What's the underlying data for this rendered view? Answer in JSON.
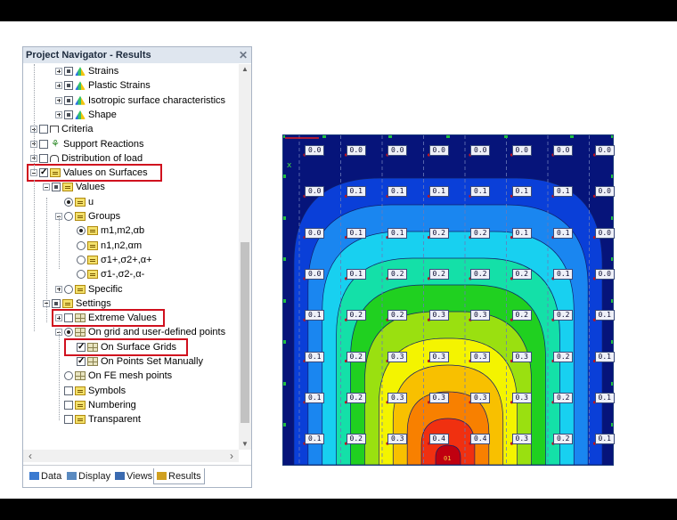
{
  "navigator": {
    "title": "Project Navigator - Results",
    "close_glyph": "✕",
    "items": [
      {
        "label": "Strains",
        "depth": 3,
        "expander": "plus",
        "check": "partial",
        "icon": "result-icon"
      },
      {
        "label": "Plastic Strains",
        "depth": 3,
        "expander": "plus",
        "check": "partial",
        "icon": "result-icon"
      },
      {
        "label": "Isotropic surface characteristics",
        "depth": 3,
        "expander": "plus",
        "check": "partial",
        "icon": "result-icon"
      },
      {
        "label": "Shape",
        "depth": 3,
        "expander": "plus",
        "check": "partial",
        "icon": "result-icon"
      },
      {
        "label": "Criteria",
        "depth": 1,
        "expander": "plus",
        "check": "none",
        "icon": "criteria-icon"
      },
      {
        "label": "Support Reactions",
        "depth": 1,
        "expander": "plus",
        "check": "none",
        "icon": "support-icon"
      },
      {
        "label": "Distribution of load",
        "depth": 1,
        "expander": "plus",
        "check": "none",
        "icon": "load-icon"
      },
      {
        "label": "Values on Surfaces",
        "depth": 1,
        "expander": "minus",
        "check": "checked",
        "icon": "values-icon"
      },
      {
        "label": "Values",
        "depth": 2,
        "expander": "minus",
        "check": "partial",
        "icon": "values-icon"
      },
      {
        "label": "u",
        "depth": 3,
        "expander": "",
        "radio": "on",
        "icon": "values-icon"
      },
      {
        "label": "Groups",
        "depth": 3,
        "expander": "minus",
        "radio": "off",
        "icon": "values-icon"
      },
      {
        "label": "m1,m2,αb",
        "depth": 4,
        "expander": "",
        "radio": "on",
        "icon": "values-icon"
      },
      {
        "label": "n1,n2,αm",
        "depth": 4,
        "expander": "",
        "radio": "off",
        "icon": "values-icon"
      },
      {
        "label": "σ1+,σ2+,α+",
        "depth": 4,
        "expander": "",
        "radio": "off",
        "icon": "values-icon"
      },
      {
        "label": "σ1-,σ2-,α-",
        "depth": 4,
        "expander": "",
        "radio": "off",
        "icon": "values-icon"
      },
      {
        "label": "Specific",
        "depth": 3,
        "expander": "plus",
        "radio": "off",
        "icon": "values-icon"
      },
      {
        "label": "Settings",
        "depth": 2,
        "expander": "minus",
        "check": "partial",
        "icon": "values-icon"
      },
      {
        "label": "Extreme Values",
        "depth": 3,
        "expander": "plus",
        "check": "none",
        "icon": "grid-icon"
      },
      {
        "label": "On grid and user-defined points",
        "depth": 3,
        "expander": "minus",
        "radio": "on",
        "icon": "grid-icon"
      },
      {
        "label": "On Surface Grids",
        "depth": 4,
        "expander": "",
        "check": "checked",
        "icon": "grid-icon"
      },
      {
        "label": "On Points Set Manually",
        "depth": 4,
        "expander": "",
        "check": "checked",
        "icon": "grid-icon"
      },
      {
        "label": "On FE mesh points",
        "depth": 3,
        "expander": "",
        "radio": "off",
        "icon": "grid-icon"
      },
      {
        "label": "Symbols",
        "depth": 3,
        "expander": "",
        "check": "none",
        "icon": "values-icon"
      },
      {
        "label": "Numbering",
        "depth": 3,
        "expander": "",
        "check": "none",
        "icon": "values-icon"
      },
      {
        "label": "Transparent",
        "depth": 3,
        "expander": "",
        "check": "none",
        "icon": "values-icon"
      }
    ],
    "highlighted": [
      "Values on Surfaces",
      "Extreme Values",
      "On Surface Grids"
    ],
    "tabs": [
      {
        "label": "Data",
        "icon": "data-icon",
        "active": false
      },
      {
        "label": "Display",
        "icon": "display-icon",
        "active": false
      },
      {
        "label": "Views",
        "icon": "views-icon",
        "active": false
      },
      {
        "label": "Results",
        "icon": "results-icon",
        "active": true
      }
    ]
  },
  "contour": {
    "grid_values": [
      [
        "0.0",
        "0.0",
        "0.0",
        "0.0",
        "0.0",
        "0.0",
        "0.0",
        "0.0"
      ],
      [
        "0.0",
        "0.1",
        "0.1",
        "0.1",
        "0.1",
        "0.1",
        "0.1",
        "0.0"
      ],
      [
        "0.0",
        "0.1",
        "0.1",
        "0.2",
        "0.2",
        "0.1",
        "0.1",
        "0.0"
      ],
      [
        "0.0",
        "0.1",
        "0.2",
        "0.2",
        "0.2",
        "0.2",
        "0.1",
        "0.0"
      ],
      [
        "0.1",
        "0.2",
        "0.2",
        "0.3",
        "0.3",
        "0.2",
        "0.2",
        "0.1"
      ],
      [
        "0.1",
        "0.2",
        "0.3",
        "0.3",
        "0.3",
        "0.3",
        "0.2",
        "0.1"
      ],
      [
        "0.1",
        "0.2",
        "0.3",
        "0.3",
        "0.3",
        "0.3",
        "0.2",
        "0.1"
      ],
      [
        "0.1",
        "0.2",
        "0.3",
        "0.4",
        "0.4",
        "0.3",
        "0.2",
        "0.1"
      ]
    ],
    "band_colors": [
      "#06147a",
      "#0a3fd8",
      "#1a86f0",
      "#18d0f0",
      "#14e0a8",
      "#20d020",
      "#9ae010",
      "#f4f400",
      "#f8c000",
      "#f88000",
      "#f03010",
      "#c00010"
    ],
    "axis_label": "x",
    "bottom_label": "01"
  }
}
